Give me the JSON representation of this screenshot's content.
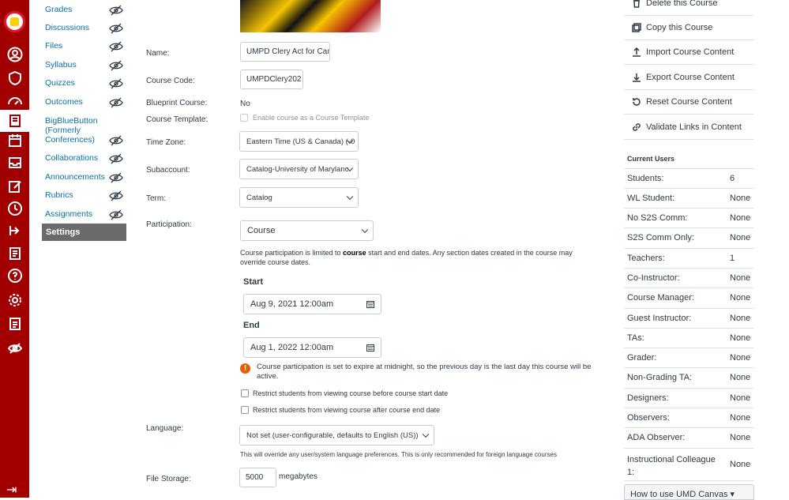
{
  "course_nav": {
    "items": [
      {
        "label": "Grades",
        "hidden": true
      },
      {
        "label": "Discussions",
        "hidden": true
      },
      {
        "label": "Files",
        "hidden": true
      },
      {
        "label": "Syllabus",
        "hidden": true
      },
      {
        "label": "Quizzes",
        "hidden": true
      },
      {
        "label": "Outcomes",
        "hidden": true
      },
      {
        "label": "BigBlueButton (Formerly Conferences)",
        "hidden": true
      },
      {
        "label": "Collaborations",
        "hidden": true
      },
      {
        "label": "Announcements",
        "hidden": true
      },
      {
        "label": "Rubrics",
        "hidden": true
      },
      {
        "label": "Assignments",
        "hidden": true
      }
    ],
    "active": "Settings"
  },
  "form": {
    "name_label": "Name:",
    "name_value": "UMPD Clery Act for Can",
    "code_label": "Course Code:",
    "code_value": "UMPDClery202",
    "blueprint_label": "Blueprint Course:",
    "blueprint_value": "No",
    "template_label": "Course Template:",
    "template_option": "Enable course as a Course Template",
    "timezone_label": "Time Zone:",
    "timezone_value": "Eastern Time (US & Canada) (-0",
    "subaccount_label": "Subaccount:",
    "subaccount_value": "Catalog-University of Marylanc",
    "term_label": "Term:",
    "term_value": "Catalog",
    "participation_label": "Participation:",
    "participation_value": "Course",
    "participation_note_pre": "Course participation is limited to ",
    "participation_note_bold": "course",
    "participation_note_post": " start and end dates. Any section dates created in the course may override course dates.",
    "start_label": "Start",
    "start_value": "Aug 9, 2021 12:00am",
    "end_label": "End",
    "end_value": "Aug 1, 2022 12:00am",
    "warning": "Course participation is set to expire at midnight, so the previous day is the last day this course will be active.",
    "restrict_before": "Restrict students from viewing course before course start date",
    "restrict_after": "Restrict students from viewing course after course end date",
    "language_label": "Language:",
    "language_value": "Not set (user-configurable, defaults to English (US))",
    "language_note": "This will override any user/system language preferences. This is only recommended for foreign language courses",
    "storage_label": "File Storage:",
    "storage_value": "5000",
    "storage_unit": "megabytes"
  },
  "sidebar": {
    "links": [
      {
        "label": "Delete this Course",
        "icon": "trash-icon"
      },
      {
        "label": "Copy this Course",
        "icon": "copy-icon"
      },
      {
        "label": "Import Course Content",
        "icon": "upload-icon"
      },
      {
        "label": "Export Course Content",
        "icon": "download-icon"
      },
      {
        "label": "Reset Course Content",
        "icon": "reset-icon"
      },
      {
        "label": "Validate Links in Content",
        "icon": "link-icon"
      }
    ],
    "current_users_title": "Current Users",
    "users": [
      {
        "role": "Students:",
        "count": "6"
      },
      {
        "role": "WL Student:",
        "count": "None"
      },
      {
        "role": "No S2S Comm:",
        "count": "None"
      },
      {
        "role": "S2S Comm Only:",
        "count": "None"
      },
      {
        "role": "Teachers:",
        "count": "1"
      },
      {
        "role": "Co-Instructor:",
        "count": "None"
      },
      {
        "role": "Course Manager:",
        "count": "None"
      },
      {
        "role": "Guest Instructor:",
        "count": "None"
      },
      {
        "role": "TAs:",
        "count": "None"
      },
      {
        "role": "Grader:",
        "count": "None"
      },
      {
        "role": "Non-Grading TA:",
        "count": "None"
      },
      {
        "role": "Designers:",
        "count": "None"
      },
      {
        "role": "Observers:",
        "count": "None"
      },
      {
        "role": "ADA Observer:",
        "count": "None"
      },
      {
        "role": "Instructional Colleague 1:",
        "count": "None"
      }
    ],
    "how_to": "How to use UMD Canvas ▾"
  },
  "colors": {
    "brand": "#a20000",
    "link": "#0770a3",
    "warning": "#e66000"
  }
}
